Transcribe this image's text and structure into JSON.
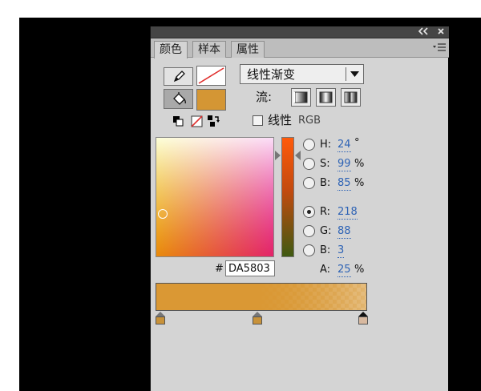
{
  "colors": {
    "fill": "#D49634",
    "accent_value": "#2E63B5",
    "stop_colors": [
      "#C8923A",
      "#C8923A",
      "#D8B9A0"
    ]
  },
  "titlebar": {
    "collapse_icon": "double-chevron-left-icon",
    "close_icon": "close-icon"
  },
  "tabs": [
    {
      "label": "颜色",
      "active": true
    },
    {
      "label": "样本",
      "active": false
    },
    {
      "label": "属性",
      "active": false
    }
  ],
  "panel_menu_icon": "panel-menu-icon",
  "tools": {
    "stroke_tool_icon": "pencil-icon",
    "fill_tool_icon": "paint-bucket-icon",
    "stroke_color": "none",
    "fill_color": "#D49634",
    "mini_icons": [
      "black-white-icon",
      "no-color-icon",
      "swap-colors-icon"
    ]
  },
  "fill_type": {
    "selected": "线性渐变"
  },
  "flow": {
    "label": "流:",
    "modes": [
      "extend-icon",
      "reflect-icon",
      "repeat-icon"
    ]
  },
  "linear_rgb": {
    "label": "线性",
    "suffix": "RGB",
    "checked": false
  },
  "fields": [
    {
      "key": "H",
      "label": "H:",
      "value": "24",
      "unit": "°",
      "selected": false
    },
    {
      "key": "S",
      "label": "S:",
      "value": "99",
      "unit": "%",
      "selected": false
    },
    {
      "key": "Bv",
      "label": "B:",
      "value": "85",
      "unit": "%",
      "selected": false
    },
    {
      "key": "R",
      "label": "R:",
      "value": "218",
      "unit": "",
      "selected": true
    },
    {
      "key": "G",
      "label": "G:",
      "value": "88",
      "unit": "",
      "selected": false
    },
    {
      "key": "Bc",
      "label": "B:",
      "value": "3",
      "unit": "",
      "selected": false
    }
  ],
  "alpha": {
    "label": "A:",
    "value": "25",
    "unit": "%"
  },
  "hex": {
    "hash": "#",
    "value": "DA5803"
  },
  "gradient": {
    "stops": [
      0.0,
      0.48,
      1.0
    ],
    "selected_stop": 2,
    "end_alpha": 0.25
  }
}
